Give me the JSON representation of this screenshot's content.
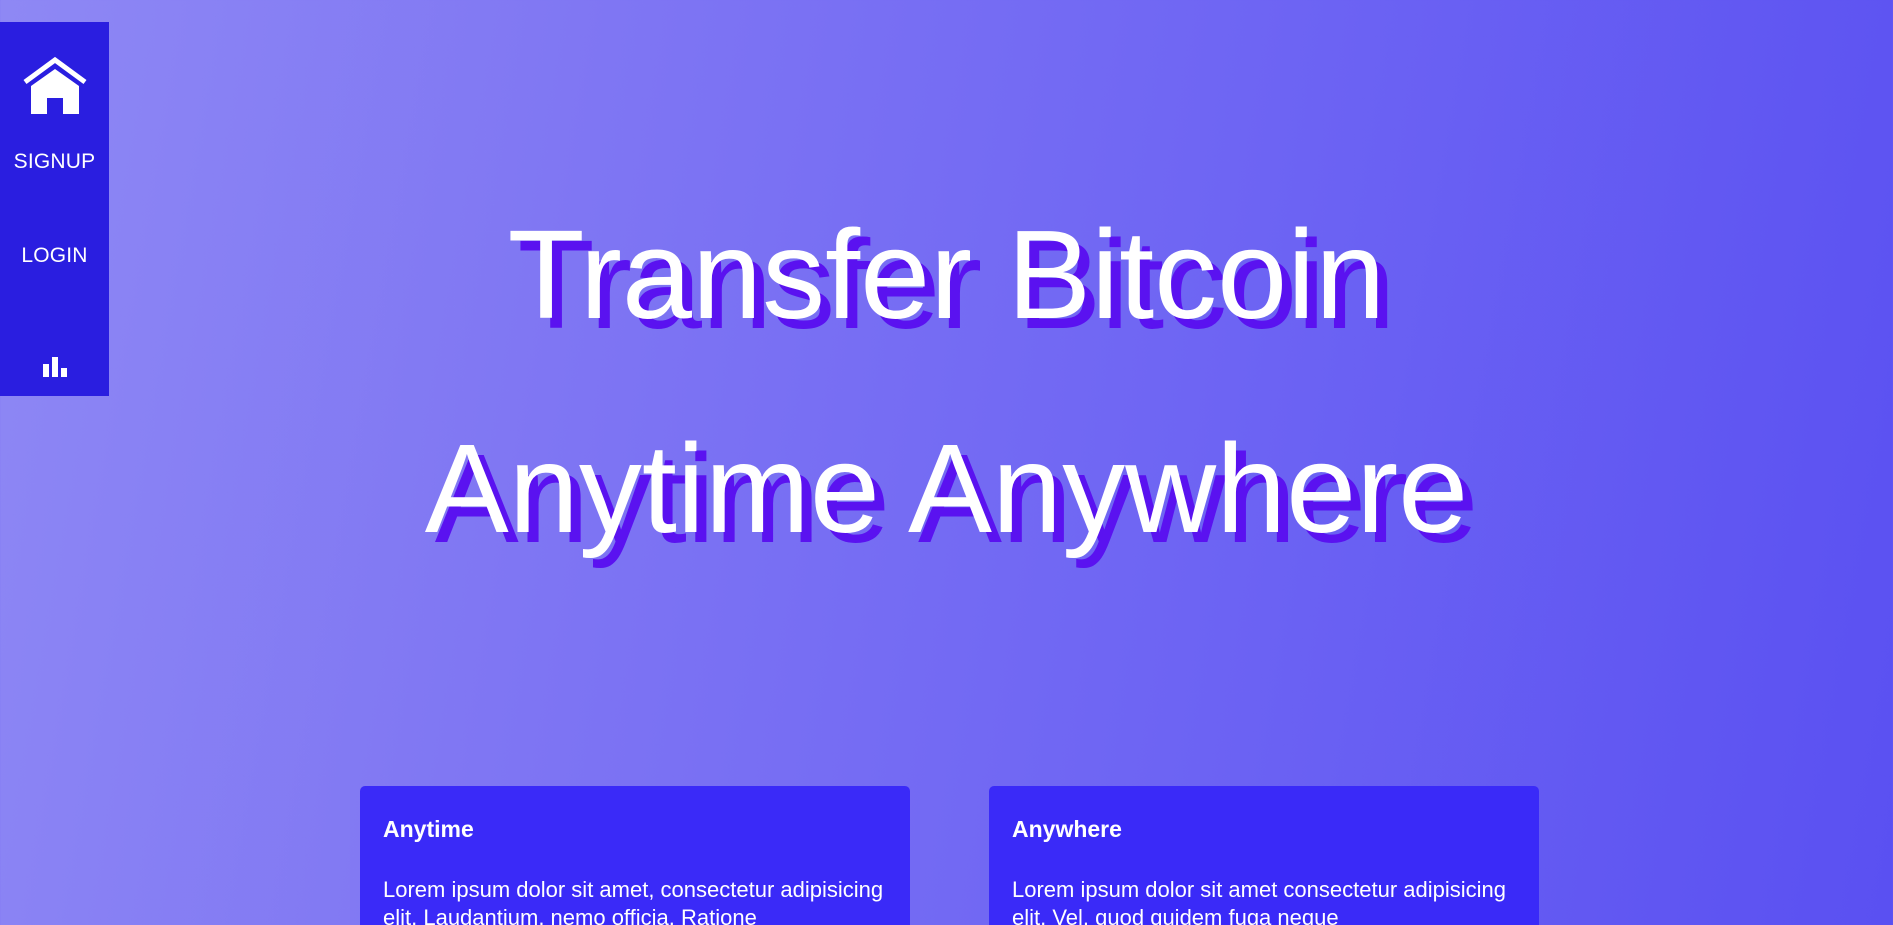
{
  "sidebar": {
    "home_icon": "home-icon",
    "signup_label": "SIGNUP",
    "login_label": "LOGIN",
    "stats_icon": "bar-chart-icon"
  },
  "hero": {
    "line1": "Transfer Bitcoin",
    "line2": "Anytime Anywhere"
  },
  "cards": [
    {
      "title": "Anytime",
      "body": "Lorem ipsum dolor sit amet, consectetur adipisicing elit. Laudantium, nemo officia. Ratione"
    },
    {
      "title": "Anywhere",
      "body": "Lorem ipsum dolor sit amet consectetur adipisicing elit. Vel, quod quidem fuga neque"
    }
  ],
  "colors": {
    "background_start": "#8e88f4",
    "background_end": "#5a50f2",
    "sidebar": "#2a1ee0",
    "card": "#3a2af8",
    "text_shadow": "#5a12f0",
    "text": "#ffffff"
  }
}
